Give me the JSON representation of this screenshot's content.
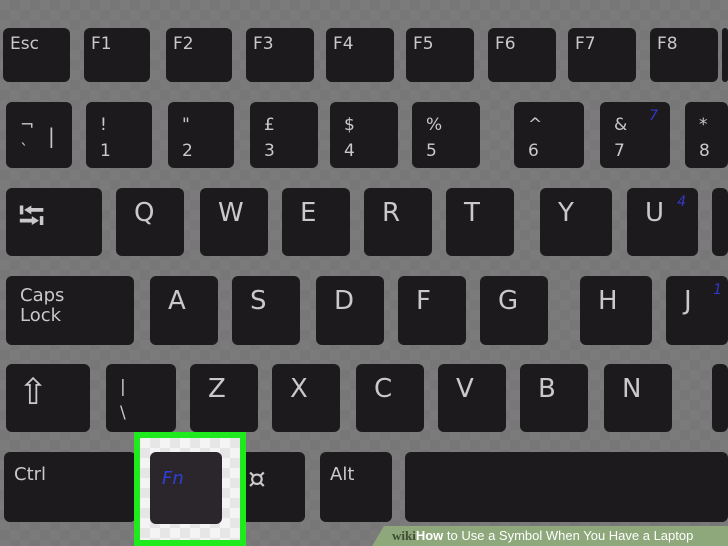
{
  "rows": [
    [
      {
        "label": "Esc"
      },
      {
        "label": "F1"
      },
      {
        "label": "F2"
      },
      {
        "label": "F3"
      },
      {
        "label": "F4"
      },
      {
        "label": "F5"
      },
      {
        "label": "F6"
      },
      {
        "label": "F7"
      },
      {
        "label": "F8"
      },
      {
        "label": ""
      }
    ],
    [
      {
        "label": "¬\n`",
        "side": "|"
      },
      {
        "label": "!\n1"
      },
      {
        "label": "\"\n2"
      },
      {
        "label": "£\n3"
      },
      {
        "label": "$\n4"
      },
      {
        "label": "%\n5"
      },
      {
        "label": "^\n6"
      },
      {
        "label": "&\n7",
        "alt": "7"
      },
      {
        "label": "*\n8"
      }
    ],
    [
      {
        "label": "⭾",
        "icon": "tab-icon"
      },
      {
        "label": "Q"
      },
      {
        "label": "W"
      },
      {
        "label": "E"
      },
      {
        "label": "R"
      },
      {
        "label": "T"
      },
      {
        "label": "Y"
      },
      {
        "label": "U",
        "alt": "4"
      },
      {
        "label": ""
      }
    ],
    [
      {
        "label": "Caps\nLock"
      },
      {
        "label": "A"
      },
      {
        "label": "S"
      },
      {
        "label": "D"
      },
      {
        "label": "F"
      },
      {
        "label": "G"
      },
      {
        "label": "H"
      },
      {
        "label": "J",
        "alt": "1"
      }
    ],
    [
      {
        "label": "⇧",
        "icon": "shift-icon"
      },
      {
        "label": "|\n\\"
      },
      {
        "label": "Z"
      },
      {
        "label": "X"
      },
      {
        "label": "C"
      },
      {
        "label": "V"
      },
      {
        "label": "B"
      },
      {
        "label": "N"
      },
      {
        "label": ""
      }
    ],
    [
      {
        "label": "Ctrl"
      },
      {
        "label": "¤",
        "icon": "windows-key-icon"
      },
      {
        "label": "Alt"
      },
      {
        "label": ""
      }
    ]
  ],
  "highlighted_key": {
    "label": "Fn"
  },
  "highlight_color": "#1eea1e",
  "banner": {
    "wiki": "wiki",
    "how": "How",
    "title": " to Use a Symbol When You Have a Laptop"
  }
}
